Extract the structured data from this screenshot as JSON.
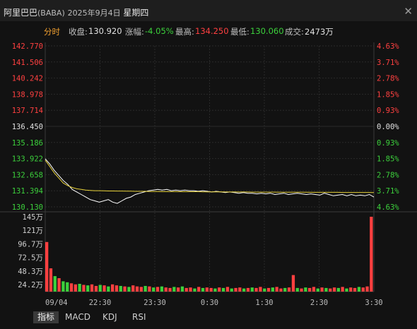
{
  "window": {
    "title_name": "阿里巴巴",
    "title_symbol": "(BABA)",
    "title_date": "2025年9月4日",
    "title_weekday": "星期四",
    "close_glyph": "✕"
  },
  "info": {
    "tab_label": "分时",
    "close_label": "收盘:",
    "close_value": "130.920",
    "change_label": "涨幅:",
    "change_value": "-4.05%",
    "high_label": "最高:",
    "high_value": "134.250",
    "low_label": "最低:",
    "low_value": "130.060",
    "volume_label": "成交:",
    "volume_value": "2473万"
  },
  "tabs": {
    "indicator": "指标",
    "macd": "MACD",
    "kdj": "KDJ",
    "rsi": "RSI"
  },
  "colors": {
    "up": "#ff4040",
    "down": "#3cd13c",
    "price_line": "#ffffff",
    "avg_line": "#e8d23a",
    "neutral": "#e0e0e0"
  },
  "chart_data": {
    "type": "line",
    "price_ticks": [
      "142.770",
      "141.506",
      "140.242",
      "138.978",
      "137.714",
      "136.450",
      "135.186",
      "133.922",
      "132.658",
      "131.394",
      "130.130"
    ],
    "pct_ticks": [
      "4.63%",
      "3.71%",
      "2.78%",
      "1.85%",
      "0.93%",
      "0.00%",
      "0.93%",
      "1.85%",
      "2.78%",
      "3.71%",
      "4.63%"
    ],
    "ylim": [
      130.13,
      142.77
    ],
    "prev_close": 136.45,
    "volume_ticks": [
      "145万",
      "121万",
      "96.7万",
      "72.5万",
      "48.3万",
      "24.2万"
    ],
    "volume_ylim": [
      0,
      145
    ],
    "time_labels": [
      "09/04",
      "22:30",
      "23:30",
      "0:30",
      "1:30",
      "2:30",
      "3:30"
    ],
    "series": [
      {
        "name": "price",
        "values": [
          133.9,
          133.5,
          133.0,
          132.6,
          132.2,
          131.9,
          131.5,
          131.3,
          131.1,
          130.9,
          130.7,
          130.6,
          130.5,
          130.6,
          130.7,
          130.5,
          130.4,
          130.6,
          130.8,
          130.9,
          131.1,
          131.2,
          131.3,
          131.4,
          131.45,
          131.5,
          131.45,
          131.5,
          131.4,
          131.45,
          131.4,
          131.45,
          131.4,
          131.4,
          131.35,
          131.4,
          131.35,
          131.3,
          131.35,
          131.3,
          131.25,
          131.3,
          131.25,
          131.2,
          131.25,
          131.2,
          131.2,
          131.15,
          131.2,
          131.15,
          131.2,
          131.1,
          131.15,
          131.2,
          131.1,
          131.15,
          131.2,
          131.15,
          131.1,
          131.15,
          131.1,
          131.05,
          131.2,
          131.1,
          131.0,
          131.05,
          131.1,
          131.0,
          131.1,
          131.0,
          131.05,
          131.0,
          131.1,
          130.9
        ]
      },
      {
        "name": "average",
        "values": [
          133.8,
          133.3,
          132.8,
          132.4,
          132.0,
          131.8,
          131.65,
          131.55,
          131.5,
          131.45,
          131.42,
          131.4,
          131.4,
          131.39,
          131.38,
          131.38,
          131.37,
          131.37,
          131.36,
          131.36,
          131.35,
          131.35,
          131.35,
          131.34,
          131.34,
          131.34,
          131.33,
          131.33,
          131.33,
          131.33,
          131.32,
          131.32,
          131.32,
          131.32,
          131.32,
          131.31,
          131.31,
          131.31,
          131.31,
          131.31,
          131.3,
          131.3,
          131.3,
          131.3,
          131.3,
          131.3,
          131.29,
          131.29,
          131.29,
          131.29,
          131.29,
          131.29,
          131.28,
          131.28,
          131.28,
          131.28,
          131.28,
          131.28,
          131.28,
          131.27,
          131.27,
          131.27,
          131.27,
          131.27,
          131.27,
          131.27,
          131.26,
          131.26,
          131.26,
          131.26,
          131.26,
          131.26,
          131.26,
          131.25
        ]
      }
    ],
    "volume": [
      96,
      45,
      30,
      26,
      20,
      18,
      16,
      14,
      15,
      13,
      12,
      14,
      11,
      13,
      12,
      10,
      14,
      12,
      11,
      10,
      9,
      12,
      10,
      9,
      11,
      10,
      8,
      9,
      10,
      8,
      7,
      9,
      8,
      10,
      7,
      8,
      6,
      9,
      7,
      8,
      7,
      6,
      8,
      7,
      9,
      6,
      7,
      8,
      6,
      7,
      8,
      7,
      9,
      6,
      7,
      8,
      9,
      6,
      7,
      8,
      32,
      7,
      6,
      8,
      7,
      9,
      6,
      8,
      7,
      6,
      8,
      7,
      9,
      6,
      8,
      7,
      9,
      8,
      10,
      145
    ],
    "volume_up": [
      1,
      1,
      0,
      1,
      0,
      0,
      1,
      1,
      0,
      1,
      0,
      1,
      1,
      0,
      1,
      0,
      1,
      1,
      0,
      1,
      0,
      1,
      1,
      1,
      0,
      1,
      0,
      1,
      0,
      1,
      1,
      0,
      1,
      0,
      1,
      1,
      0,
      1,
      0,
      1,
      1,
      0,
      1,
      0,
      1,
      0,
      1,
      1,
      0,
      1,
      0,
      1,
      1,
      0,
      1,
      0,
      1,
      1,
      0,
      1,
      1,
      0,
      1,
      0,
      1,
      1,
      0,
      1,
      0,
      1,
      1,
      0,
      1,
      0,
      1,
      1,
      0,
      1,
      1,
      1
    ]
  }
}
